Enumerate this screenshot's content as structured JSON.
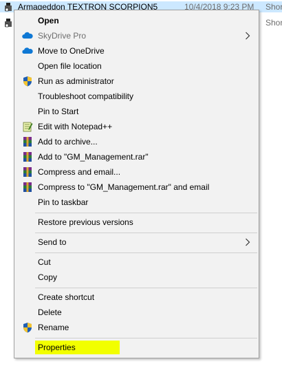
{
  "files": [
    {
      "name": "Armageddon TEXTRON SCORPION5",
      "date": "10/4/2018 9:23 PM",
      "type": "Shor",
      "selected": true
    },
    {
      "name": "",
      "date": "",
      "type": "Shor",
      "selected": false
    }
  ],
  "menu": {
    "items": [
      {
        "label": "Open",
        "icon": "none"
      },
      {
        "label": "SkyDrive Pro",
        "icon": "cloud-icon"
      },
      {
        "label": "Move to OneDrive",
        "icon": "onedrive-icon"
      },
      {
        "label": "Open file location",
        "icon": "none"
      },
      {
        "label": "Run as administrator",
        "icon": "shield-icon"
      },
      {
        "label": "Troubleshoot compatibility",
        "icon": "none"
      },
      {
        "label": "Pin to Start",
        "icon": "none"
      },
      {
        "label": "Edit with Notepad++",
        "icon": "notepad-icon"
      },
      {
        "label": "Add to archive...",
        "icon": "winrar-icon"
      },
      {
        "label": "Add to \"GM_Management.rar\"",
        "icon": "winrar-icon"
      },
      {
        "label": "Compress and email...",
        "icon": "winrar-icon"
      },
      {
        "label": "Compress to \"GM_Management.rar\" and email",
        "icon": "winrar-icon"
      },
      {
        "label": "Pin to taskbar",
        "icon": "none"
      },
      {
        "label": "Restore previous versions",
        "icon": "none"
      },
      {
        "label": "Send to",
        "icon": "none"
      },
      {
        "label": "Cut",
        "icon": "none"
      },
      {
        "label": "Copy",
        "icon": "none"
      },
      {
        "label": "Create shortcut",
        "icon": "none"
      },
      {
        "label": "Delete",
        "icon": "none"
      },
      {
        "label": "Rename",
        "icon": "shield-icon"
      },
      {
        "label": "Properties",
        "icon": "none"
      }
    ]
  },
  "colors": {
    "menu_bg": "#f2f2f2",
    "selection": "#cce8ff",
    "highlight": "#f2ff00",
    "onedrive_blue": "#0f78d4",
    "separator": "#cfcfcf"
  }
}
